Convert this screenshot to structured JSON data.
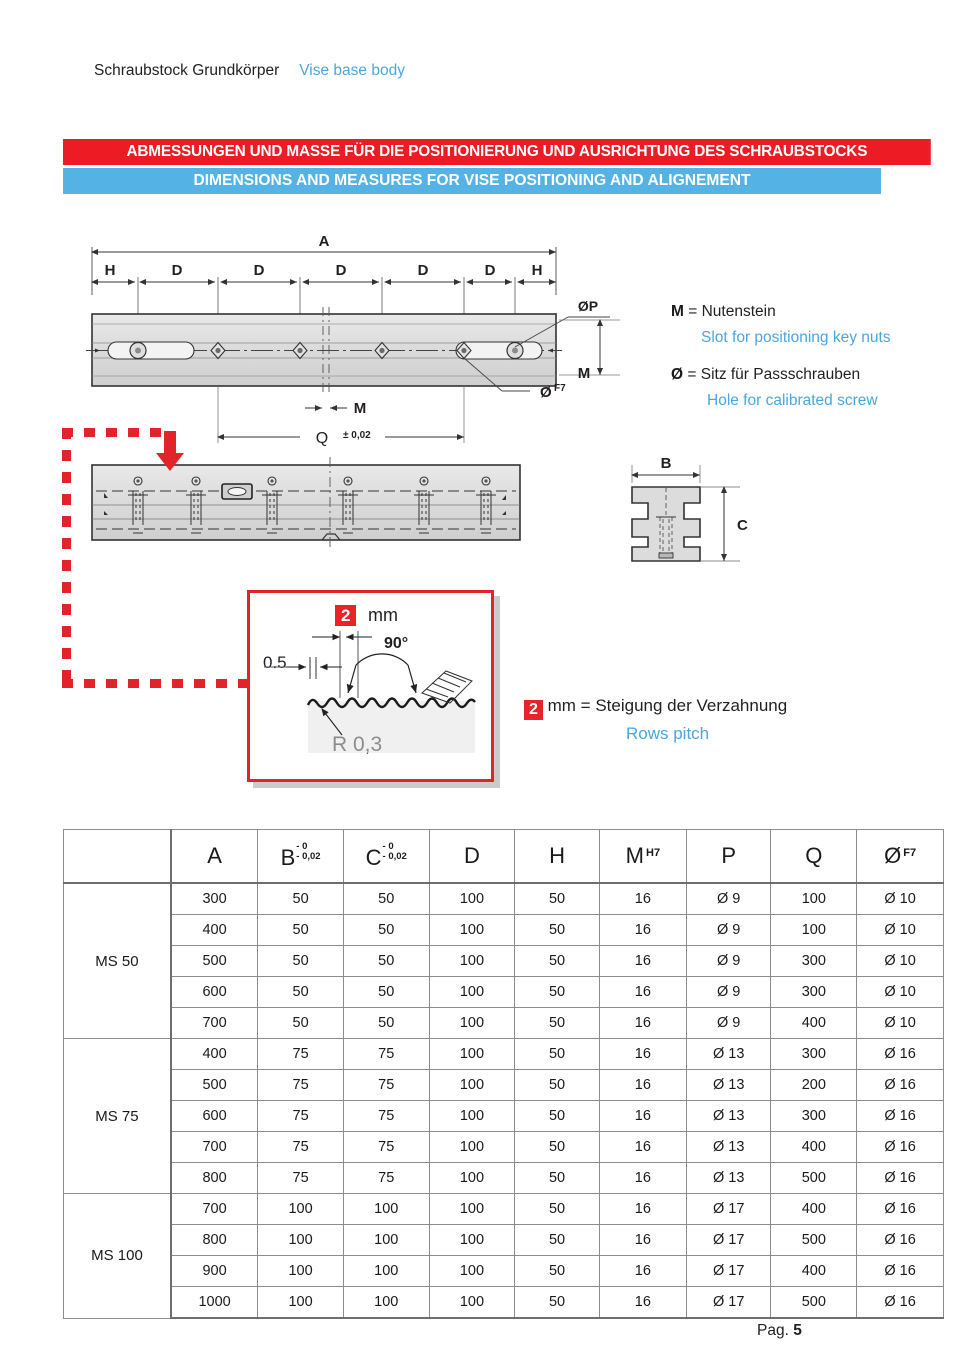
{
  "header": {
    "title_de": "Schraubstock Grundkörper",
    "title_en": "Vise base body"
  },
  "banners": {
    "red_de": "ABMESSUNGEN UND MASSE FÜR DIE POSITIONIERUNG UND AUSRICHTUNG DES SCHRAUBSTOCKS",
    "blue_en": "DIMENSIONS AND MEASURES FOR VISE POSITIONING AND ALIGNEMENT",
    "red_color": "#ed1c24",
    "blue_color": "#54b3e4"
  },
  "drawing": {
    "top_view_labels": [
      "A",
      "H",
      "D",
      "D",
      "D",
      "D",
      "D",
      "H",
      "ØP",
      "M",
      "M",
      "Ø F7",
      "Q± 0,02"
    ],
    "dim_A": "A",
    "dim_H_left": "H",
    "dim_H_right": "H",
    "dim_D": "D",
    "dim_OP": "ØP",
    "dim_M_right": "M",
    "dim_M_center": "M",
    "dim_O_F7": "Ø",
    "dim_O_F7_sup": "F7",
    "dim_Q": "Q",
    "dim_Q_tol": "± 0,02",
    "dim_B": "B",
    "dim_C": "C"
  },
  "legend": {
    "m_symbol": "M",
    "m_de": "= Nutenstein",
    "m_en": "Slot for positioning key nuts",
    "d_symbol": "Ø",
    "d_de": "= Sitz für Passschrauben",
    "d_en": "Hole for calibrated screw"
  },
  "detail": {
    "chip_value": "2",
    "mm_label": "mm",
    "label_05": "0.5",
    "label_90": "90°",
    "label_r03": "R 0,3",
    "caption_chip": "2",
    "caption_de": "mm = Steigung der Verzahnung",
    "caption_en": "Rows pitch",
    "border_color": "#e0242a",
    "chip_color": "#e8242a"
  },
  "table": {
    "headers": [
      {
        "label": "",
        "tol_top": "",
        "tol_bottom": "",
        "sup": ""
      },
      {
        "label": "A",
        "tol_top": "",
        "tol_bottom": "",
        "sup": ""
      },
      {
        "label": "B",
        "tol_top": "- 0",
        "tol_bottom": "- 0,02",
        "sup": ""
      },
      {
        "label": "C",
        "tol_top": "- 0",
        "tol_bottom": "- 0,02",
        "sup": ""
      },
      {
        "label": "D",
        "tol_top": "",
        "tol_bottom": "",
        "sup": ""
      },
      {
        "label": "H",
        "tol_top": "",
        "tol_bottom": "",
        "sup": ""
      },
      {
        "label": "M",
        "tol_top": "",
        "tol_bottom": "",
        "sup": "H7"
      },
      {
        "label": "P",
        "tol_top": "",
        "tol_bottom": "",
        "sup": ""
      },
      {
        "label": "Q",
        "tol_top": "",
        "tol_bottom": "",
        "sup": ""
      },
      {
        "label": "Ø",
        "tol_top": "",
        "tol_bottom": "",
        "sup": "F7"
      }
    ],
    "groups": [
      {
        "name": "MS 50",
        "rows": [
          [
            "300",
            "50",
            "50",
            "100",
            "50",
            "16",
            "Ø 9",
            "100",
            "Ø 10"
          ],
          [
            "400",
            "50",
            "50",
            "100",
            "50",
            "16",
            "Ø 9",
            "100",
            "Ø 10"
          ],
          [
            "500",
            "50",
            "50",
            "100",
            "50",
            "16",
            "Ø 9",
            "300",
            "Ø 10"
          ],
          [
            "600",
            "50",
            "50",
            "100",
            "50",
            "16",
            "Ø 9",
            "300",
            "Ø 10"
          ],
          [
            "700",
            "50",
            "50",
            "100",
            "50",
            "16",
            "Ø 9",
            "400",
            "Ø 10"
          ]
        ]
      },
      {
        "name": "MS 75",
        "rows": [
          [
            "400",
            "75",
            "75",
            "100",
            "50",
            "16",
            "Ø 13",
            "300",
            "Ø 16"
          ],
          [
            "500",
            "75",
            "75",
            "100",
            "50",
            "16",
            "Ø 13",
            "200",
            "Ø 16"
          ],
          [
            "600",
            "75",
            "75",
            "100",
            "50",
            "16",
            "Ø 13",
            "300",
            "Ø 16"
          ],
          [
            "700",
            "75",
            "75",
            "100",
            "50",
            "16",
            "Ø 13",
            "400",
            "Ø 16"
          ],
          [
            "800",
            "75",
            "75",
            "100",
            "50",
            "16",
            "Ø 13",
            "500",
            "Ø 16"
          ]
        ]
      },
      {
        "name": "MS 100",
        "rows": [
          [
            "700",
            "100",
            "100",
            "100",
            "50",
            "16",
            "Ø 17",
            "400",
            "Ø 16"
          ],
          [
            "800",
            "100",
            "100",
            "100",
            "50",
            "16",
            "Ø 17",
            "500",
            "Ø 16"
          ],
          [
            "900",
            "100",
            "100",
            "100",
            "50",
            "16",
            "Ø 17",
            "400",
            "Ø 16"
          ],
          [
            "1000",
            "100",
            "100",
            "100",
            "50",
            "16",
            "Ø 17",
            "500",
            "Ø 16"
          ]
        ]
      }
    ]
  },
  "footer": {
    "page_prefix": "Pag.",
    "page_number": "5"
  }
}
